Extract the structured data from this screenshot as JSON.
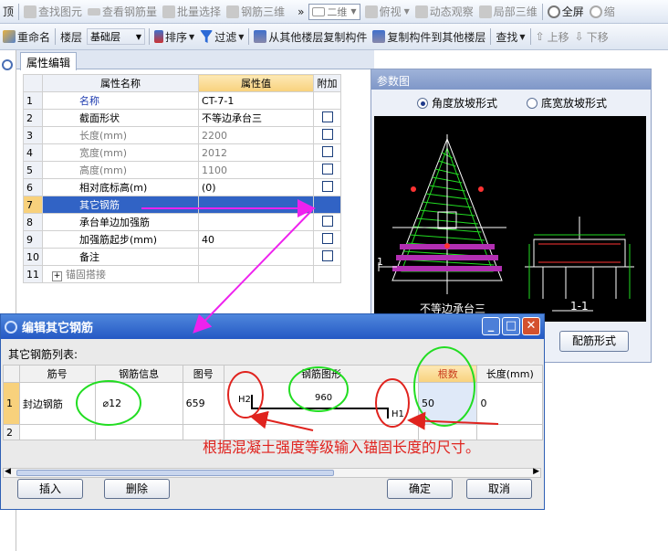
{
  "toolbar1": {
    "items": [
      "顶",
      "查找图元",
      "查看钢筋量",
      "批量选择",
      "钢筋三维",
      "»",
      "二维",
      "俯视",
      "动态观察",
      "局部三维",
      "全屏",
      "缩"
    ]
  },
  "toolbar2": {
    "items": [
      "重命名",
      "楼层",
      "基础层",
      "排序",
      "过滤",
      "从其他楼层复制构件",
      "复制构件到其他楼层",
      "查找",
      "上移",
      "下移"
    ]
  },
  "tab_label": "属性编辑",
  "prop_grid": {
    "headers": [
      "属性名称",
      "属性值",
      "附加"
    ],
    "rows": [
      {
        "no": "1",
        "name": "名称",
        "value": "CT-7-1",
        "check": false
      },
      {
        "no": "2",
        "name": "截面形状",
        "value": "不等边承台三",
        "check": true
      },
      {
        "no": "3",
        "name": "长度(mm)",
        "value": "2200",
        "check": true
      },
      {
        "no": "4",
        "name": "宽度(mm)",
        "value": "2012",
        "check": true
      },
      {
        "no": "5",
        "name": "高度(mm)",
        "value": "1100",
        "check": true
      },
      {
        "no": "6",
        "name": "相对底标高(m)",
        "value": "(0)",
        "check": true
      },
      {
        "no": "7",
        "name": "其它钢筋",
        "value": "",
        "check": false
      },
      {
        "no": "8",
        "name": "承台单边加强筋",
        "value": "",
        "check": true
      },
      {
        "no": "9",
        "name": "加强筋起步(mm)",
        "value": "40",
        "check": true
      },
      {
        "no": "10",
        "name": "备注",
        "value": "",
        "check": true
      },
      {
        "no": "11",
        "name": "锚固搭接",
        "value": "",
        "check": false
      }
    ],
    "expand_glyph": "+"
  },
  "param_dialog": {
    "title": "参数图",
    "radio1": "角度放坡形式",
    "radio2": "底宽放坡形式",
    "radio_selected": 1,
    "drawing_label": "不等边承台三",
    "section_label": "1-1",
    "marker_1": "1",
    "button": "配筋形式"
  },
  "edit_dialog": {
    "title": "编辑其它钢筋",
    "list_label": "其它钢筋列表:",
    "headers": [
      "筋号",
      "钢筋信息",
      "图号",
      "钢筋图形",
      "根数",
      "长度(mm)"
    ],
    "row1": {
      "no": "1",
      "name": "封边钢筋",
      "info": "⌀12",
      "fig": "659",
      "shape_mid": "960",
      "h2": "H2",
      "h1": "H1",
      "count": "50",
      "length": "0"
    },
    "row2": {
      "no": "2"
    },
    "btn_insert": "插入",
    "btn_delete": "删除",
    "btn_ok": "确定",
    "btn_cancel": "取消"
  },
  "annotation": "根据混凝土强度等级输入锚固长度的尺寸。",
  "colors": {
    "accent": "#3163c5",
    "header_hl": "#f8d17c",
    "red_note": "#e0231e",
    "green_circle": "#22dd22",
    "magenta_arrow": "#ee22ee"
  }
}
